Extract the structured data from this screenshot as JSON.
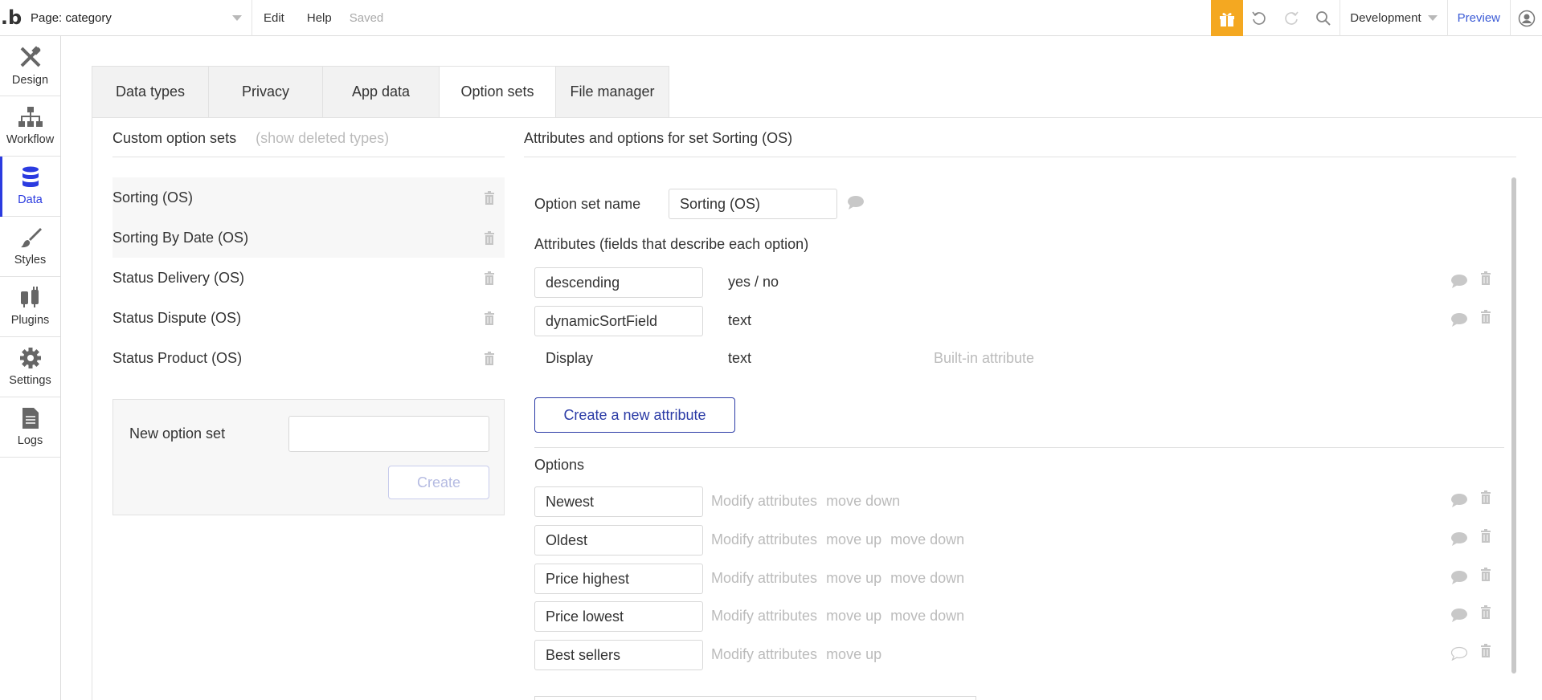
{
  "topbar": {
    "logo": ".b",
    "page_selector": "Page: category",
    "menu_edit": "Edit",
    "menu_help": "Help",
    "status": "Saved",
    "environment": "Development",
    "preview": "Preview",
    "accent_color": "#f4a821"
  },
  "sidebar": {
    "items": [
      {
        "label": "Design",
        "icon": "design-icon"
      },
      {
        "label": "Workflow",
        "icon": "workflow-icon"
      },
      {
        "label": "Data",
        "icon": "database-icon",
        "active": true
      },
      {
        "label": "Styles",
        "icon": "brush-icon"
      },
      {
        "label": "Plugins",
        "icon": "plug-icon"
      },
      {
        "label": "Settings",
        "icon": "gear-icon"
      },
      {
        "label": "Logs",
        "icon": "document-icon"
      }
    ]
  },
  "tabs": [
    {
      "label": "Data types"
    },
    {
      "label": "Privacy"
    },
    {
      "label": "App data"
    },
    {
      "label": "Option sets",
      "active": true
    },
    {
      "label": "File manager"
    }
  ],
  "option_sets_panel": {
    "title": "Custom option sets",
    "show_deleted": "(show deleted types)",
    "items": [
      {
        "label": "Sorting (OS)"
      },
      {
        "label": "Sorting By Date (OS)"
      },
      {
        "label": "Status Delivery (OS)"
      },
      {
        "label": "Status Dispute (OS)"
      },
      {
        "label": "Status Product (OS)"
      }
    ],
    "new_label": "New option set",
    "new_value": "",
    "create_label": "Create"
  },
  "detail": {
    "title": "Attributes and options for set Sorting (OS)",
    "name_label": "Option set name",
    "name_value": "Sorting (OS)",
    "attributes_label": "Attributes (fields that describe each option)",
    "attributes": [
      {
        "name": "descending",
        "type": "yes / no"
      },
      {
        "name": "dynamicSortField",
        "type": "text"
      }
    ],
    "builtin": {
      "name": "Display",
      "type": "text",
      "note": "Built-in attribute"
    },
    "create_attr_label": "Create a new attribute",
    "options_label": "Options",
    "options": [
      {
        "value": "Newest",
        "modify": "Modify attributes",
        "up": "",
        "down": "move down"
      },
      {
        "value": "Oldest",
        "modify": "Modify attributes",
        "up": "move up",
        "down": "move down"
      },
      {
        "value": "Price highest",
        "modify": "Modify attributes",
        "up": "move up",
        "down": "move down"
      },
      {
        "value": "Price lowest",
        "modify": "Modify attributes",
        "up": "move up",
        "down": "move down"
      },
      {
        "value": "Best sellers",
        "modify": "Modify attributes",
        "up": "move up",
        "down": ""
      }
    ]
  }
}
